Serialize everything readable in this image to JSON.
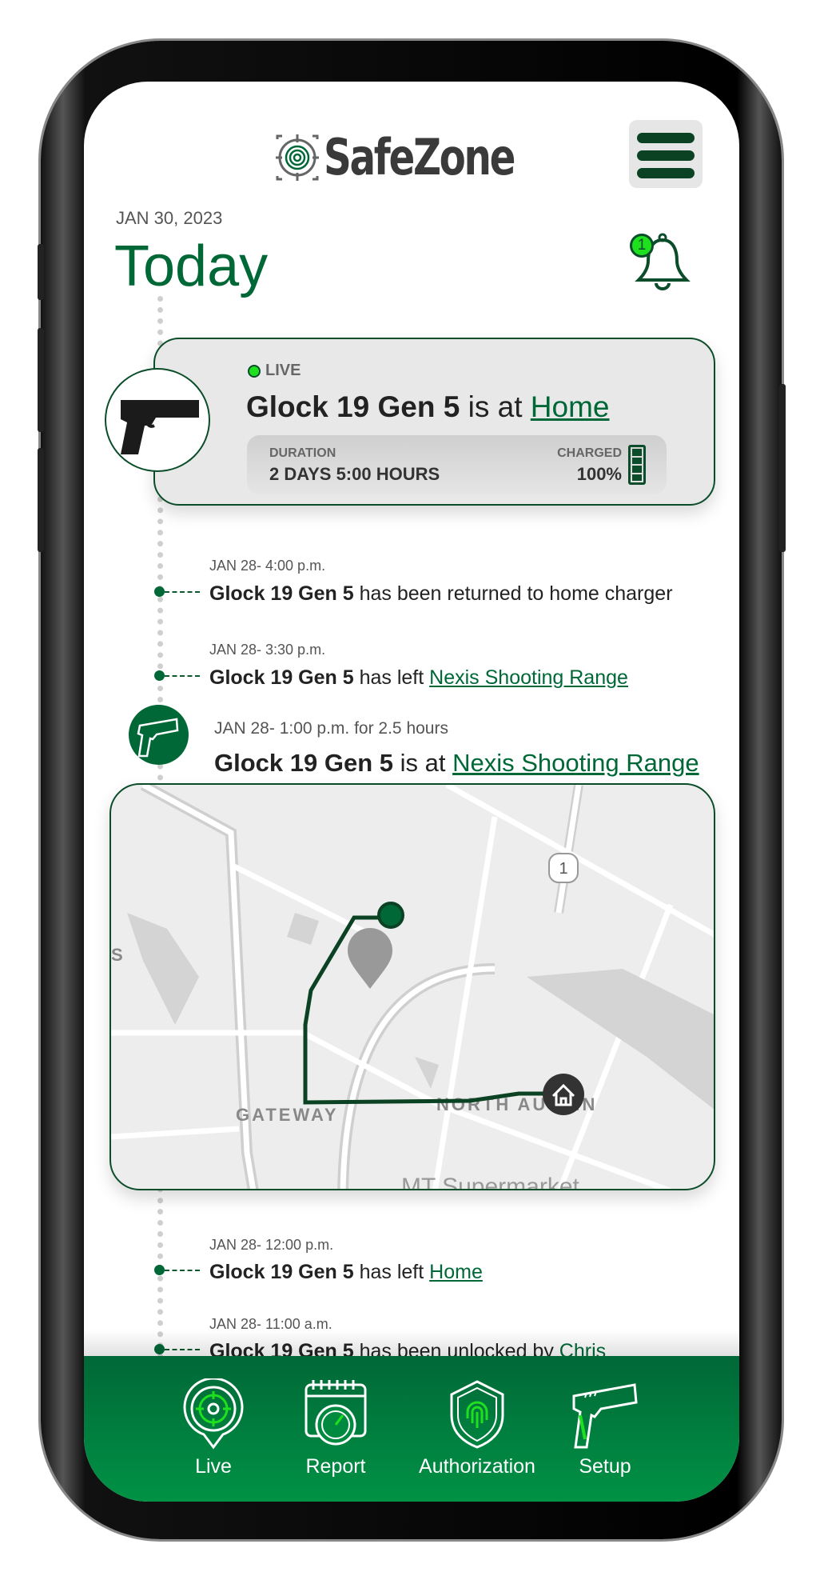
{
  "header": {
    "logo_text": "SafeZone",
    "menu_icon": "hamburger-icon"
  },
  "date": "JAN 30, 2023",
  "title": "Today",
  "notifications": {
    "icon": "bell-icon",
    "count": "1"
  },
  "live_card": {
    "status": "LIVE",
    "device": "Glock 19 Gen 5",
    "connector": "is at",
    "location": "Home",
    "duration_label": "DURATION",
    "duration_value": "2 DAYS 5:00 HOURS",
    "charged_label": "CHARGED",
    "charged_value": "100%",
    "battery_level": 1.0
  },
  "events": [
    {
      "time": "JAN 28- 4:00 p.m.",
      "device": "Glock 19 Gen 5",
      "text": "has been returned to home charger",
      "link": ""
    },
    {
      "time": "JAN 28- 3:30 p.m.",
      "device": "Glock 19 Gen 5",
      "text": "has left",
      "link": "Nexis Shooting Range"
    },
    {
      "time": "JAN 28- 1:00 p.m. for 2.5 hours",
      "device": "Glock 19 Gen 5",
      "text": "is at",
      "link": "Nexis Shooting Range"
    },
    {
      "time": "JAN 28- 12:00 p.m.",
      "device": "Glock 19 Gen 5",
      "text": "has left",
      "link": "Home"
    },
    {
      "time": "JAN 28- 11:00 a.m.",
      "device": "Glock 19 Gen 5",
      "text": "has been unlocked by",
      "link": "Chris"
    }
  ],
  "map": {
    "labels": {
      "gateway": "GATEWAY",
      "north": "NORTH AUSTIN",
      "market": "MT Supermarket",
      "route": "1",
      "edge": "S"
    }
  },
  "nav": [
    {
      "label": "Live",
      "icon": "live-target-icon"
    },
    {
      "label": "Report",
      "icon": "report-calendar-icon"
    },
    {
      "label": "Authorization",
      "icon": "fingerprint-shield-icon"
    },
    {
      "label": "Setup",
      "icon": "pistol-icon"
    }
  ],
  "colors": {
    "brand_green": "#006837",
    "live_green": "#1ee01e",
    "dark_green": "#0b4d2a"
  }
}
